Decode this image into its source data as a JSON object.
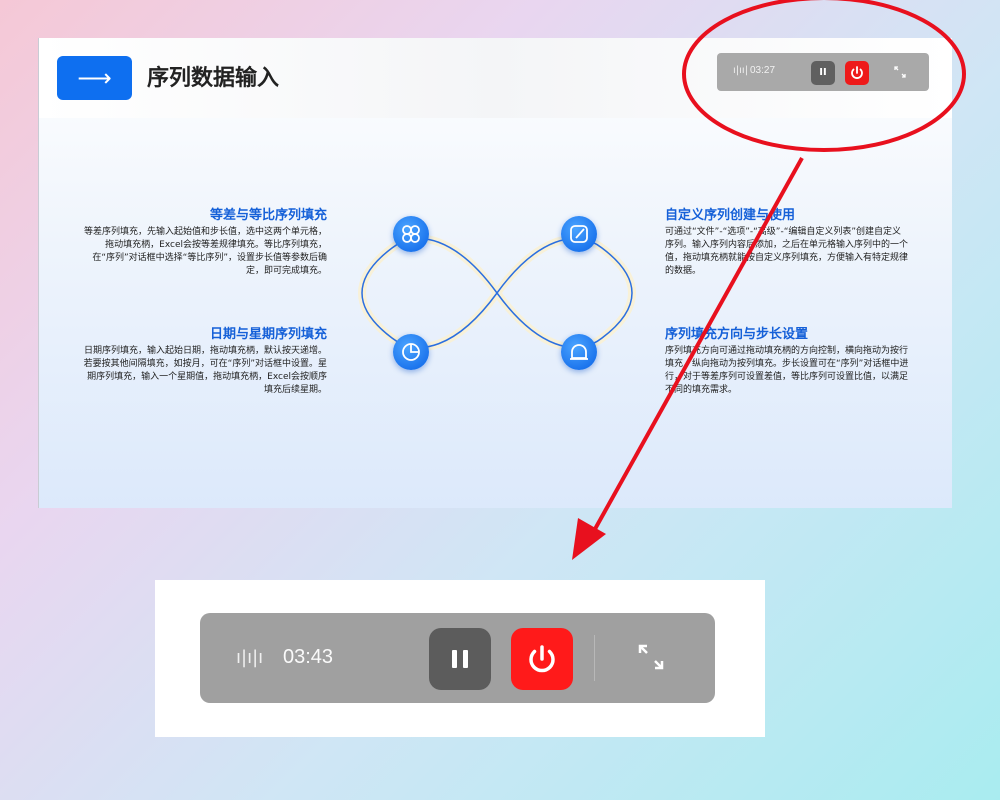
{
  "slide": {
    "title_arrow": "⟶",
    "title": "序列数据输入",
    "accent_color": "#0e6ff0",
    "mini_controls": {
      "time": "03:27",
      "wave_icon": "audio-wave-icon"
    },
    "blocks": [
      {
        "heading": "等差与等比序列填充",
        "body": "等差序列填充，先输入起始值和步长值，选中这两个单元格，拖动填充柄，Excel会按等差规律填充。等比序列填充，在“序列”对话框中选择“等比序列”，设置步长值等参数后确定，即可完成填充。"
      },
      {
        "heading": "日期与星期序列填充",
        "body": "日期序列填充，输入起始日期，拖动填充柄，默认按天递增。若要按其他间隔填充，如按月，可在“序列”对话框中设置。星期序列填充，输入一个星期值，拖动填充柄，Excel会按顺序填充后续星期。"
      },
      {
        "heading": "自定义序列创建与使用",
        "body": "可通过“文件”-“选项”-“高级”-“编辑自定义列表”创建自定义序列。输入序列内容后添加，之后在单元格输入序列中的一个值，拖动填充柄就能按自定义序列填充，方便输入有特定规律的数据。"
      },
      {
        "heading": "序列填充方向与步长设置",
        "body": "序列填充方向可通过拖动填充柄的方向控制，横向拖动为按行填充，纵向拖动为按列填充。步长设置可在“序列”对话框中进行，对于等差序列可设置差值，等比序列可设置比值，以满足不同的填充需求。"
      }
    ]
  },
  "zoom": {
    "time": "03:43",
    "wave_icon": "audio-wave-icon",
    "pause_icon": "pause-icon",
    "power_icon": "power-icon",
    "expand_icon": "expand-icon"
  },
  "annotation_color": "#e8101e"
}
